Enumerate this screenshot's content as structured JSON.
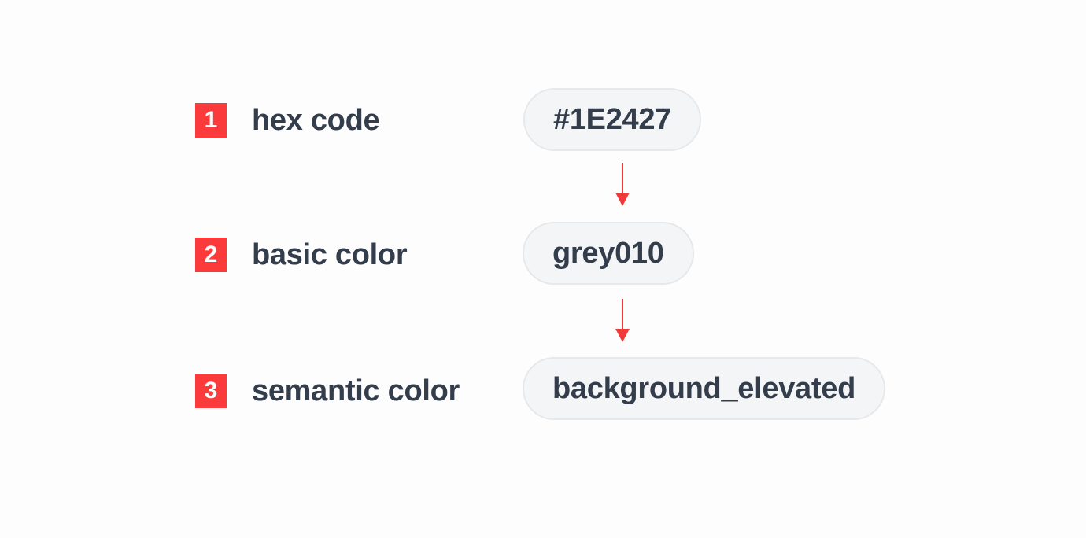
{
  "rows": [
    {
      "number": "1",
      "label": "hex code",
      "value": "#1E2427"
    },
    {
      "number": "2",
      "label": "basic color",
      "value": "grey010"
    },
    {
      "number": "3",
      "label": "semantic color",
      "value": "background_elevated"
    }
  ],
  "colors": {
    "badge": "#fb3a3b",
    "text": "#333d4b",
    "pill_background": "#f4f5f7",
    "pill_border": "#e6e8ea",
    "arrow": "#f03a3a"
  }
}
